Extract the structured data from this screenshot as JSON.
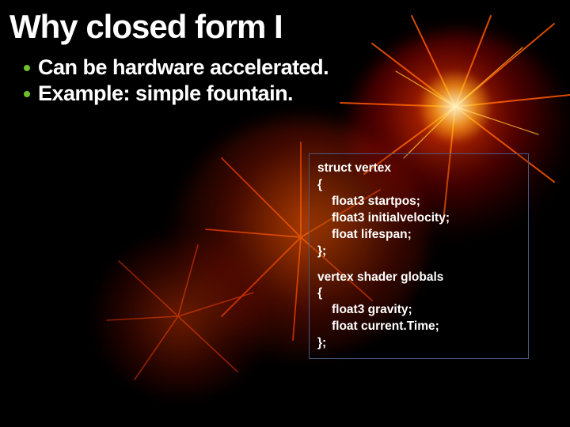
{
  "title": "Why closed form I",
  "bullets": [
    "Can be hardware accelerated.",
    "Example: simple fountain."
  ],
  "code": {
    "block1": {
      "l1": "struct vertex",
      "l2": "{",
      "l3": "float3 startpos;",
      "l4": "float3 initialvelocity;",
      "l5": "float lifespan;",
      "l6": "};"
    },
    "block2": {
      "l1": "vertex shader globals",
      "l2": "{",
      "l3": "float3 gravity;",
      "l4": "float current.Time;",
      "l5": "};"
    }
  }
}
